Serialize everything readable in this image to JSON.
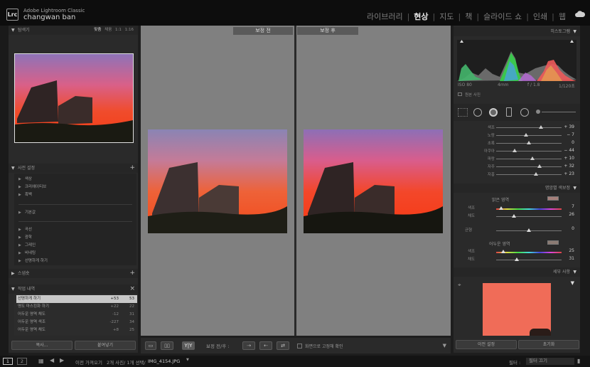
{
  "app": {
    "logo": "Lrc",
    "name": "Adobe Lightroom Classic",
    "user": "changwan ban"
  },
  "modules": [
    {
      "label": "라이브러리",
      "active": false
    },
    {
      "label": "현상",
      "active": true
    },
    {
      "label": "지도",
      "active": false
    },
    {
      "label": "책",
      "active": false
    },
    {
      "label": "슬라이드 쇼",
      "active": false
    },
    {
      "label": "인쇄",
      "active": false
    },
    {
      "label": "웹",
      "active": false
    }
  ],
  "left": {
    "navigator": {
      "title": "탐색기",
      "fit": "맞춤",
      "fill": "채움",
      "one": "1:1",
      "ratio": "1:16"
    },
    "presets": {
      "title": "사전 설정",
      "groups": [
        "색상",
        "크리에이티브",
        "흑백",
        "기본값",
        "곡선",
        "광학",
        "그레인",
        "비네팅",
        "선명하게 하기"
      ]
    },
    "snapshots": {
      "title": "스냅숏"
    },
    "history": {
      "title": "작업 내역",
      "rows": [
        {
          "label": "선명하게 하기",
          "a": "+53",
          "b": "53"
        },
        {
          "label": "명도 마스킹화 하기",
          "a": "+22",
          "b": "22"
        },
        {
          "label": "어두운 영역 채도",
          "a": "-12",
          "b": "31"
        },
        {
          "label": "어두운 영역 색조",
          "a": "-227",
          "b": "34"
        },
        {
          "label": "어두운 영역 채도",
          "a": "+8",
          "b": "25"
        }
      ]
    },
    "copy_btn": "복사...",
    "paste_btn": "붙여넣기"
  },
  "center": {
    "before": "보정 전",
    "after": "보정 후"
  },
  "toolbar": {
    "before_after": "보정 전/후 :",
    "lock_label": "화면으로 고정해 확인",
    "yy": "Y|Y"
  },
  "right": {
    "histogram": {
      "title": "히스토그램",
      "iso": "ISO 80",
      "focal": "4mm",
      "aperture": "f / 1.8",
      "shutter": "1/120초",
      "orig": "원본 사진"
    },
    "sliders": [
      {
        "label": "색조",
        "value": "+ 39",
        "pos": 0.69
      },
      {
        "label": "노랑",
        "value": "− 7",
        "pos": 0.46
      },
      {
        "label": "초록",
        "value": "0",
        "pos": 0.5
      },
      {
        "label": "아쿠아",
        "value": "− 44",
        "pos": 0.28
      },
      {
        "label": "파랑",
        "value": "+ 10",
        "pos": 0.55
      },
      {
        "label": "자주",
        "value": "+ 32",
        "pos": 0.66
      },
      {
        "label": "자홍",
        "value": "+ 23",
        "pos": 0.61
      }
    ],
    "split": {
      "title": "명암별 색보정",
      "high": "밝은 영역",
      "hue": "색조",
      "sat": "채도",
      "high_hue": "7",
      "high_sat": "26",
      "balance": "균형",
      "balance_val": "0",
      "shadow": "어두운 영역",
      "sh_hue": "25",
      "sh_sat": "31"
    },
    "detail": {
      "title": "세부 사항"
    },
    "prev_btn": "이전 설정",
    "reset_btn": "초기화"
  },
  "filmstrip": {
    "p1": "1",
    "p2": "2",
    "prev": "이전 가져오기",
    "count": "2개 사진/ 1개 선택/",
    "file": "IMG_4154.JPG",
    "filter_label": "필터 :",
    "filter": "필터 끄기"
  },
  "colors": {
    "accent": "#e6e6e6",
    "panel": "#2a2a2a",
    "center": "#808080"
  }
}
